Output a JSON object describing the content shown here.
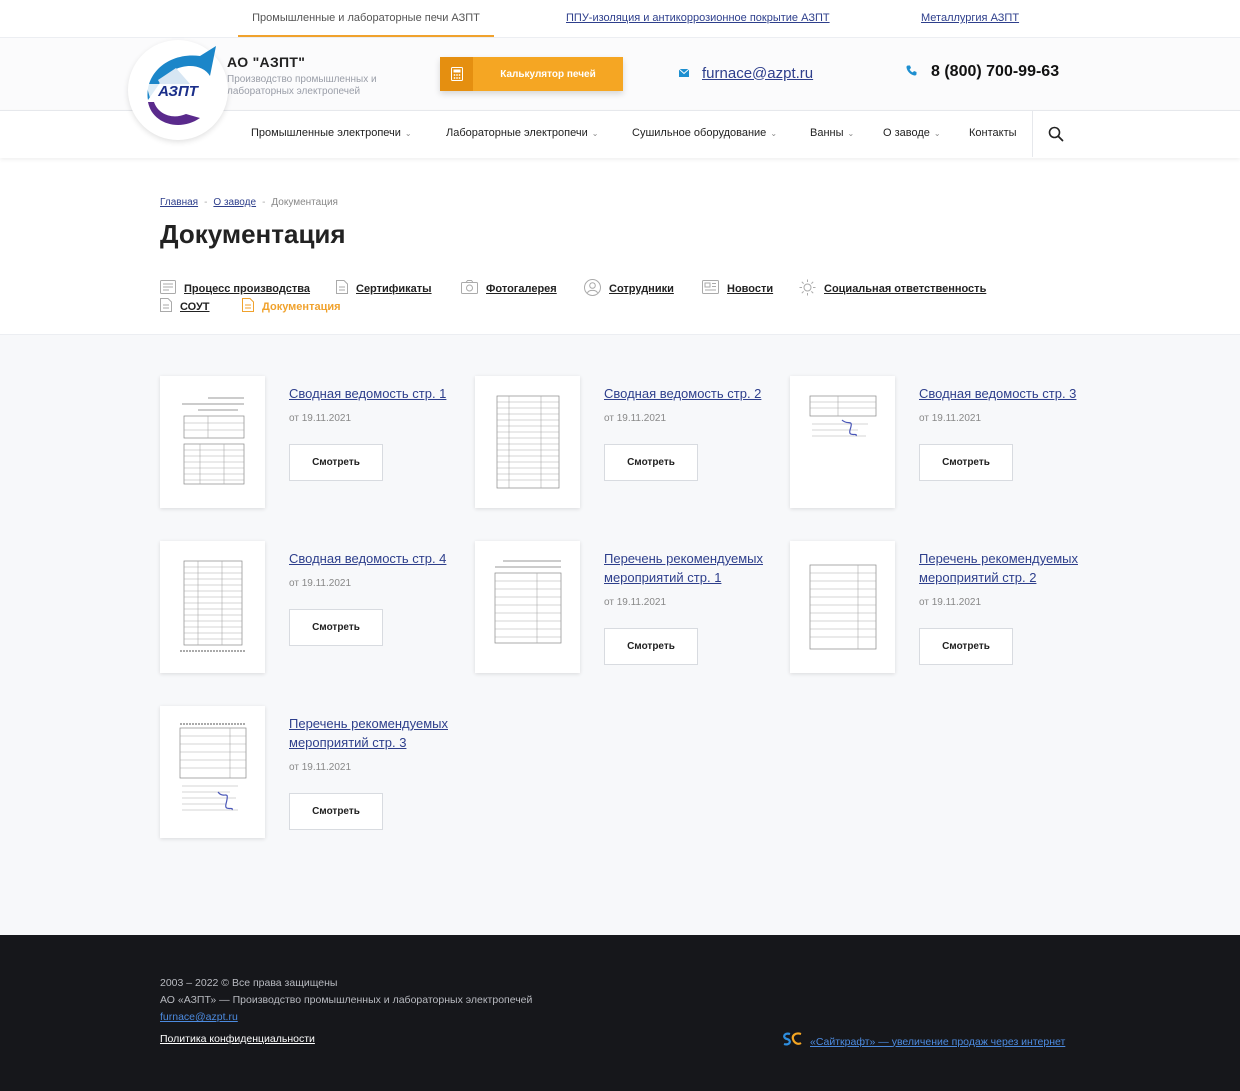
{
  "topbar": {
    "tabs": [
      {
        "label": "Промышленные и лабораторные печи АЗПТ"
      },
      {
        "label": "ППУ-изоляция и антикоррозионное покрытие АЗПТ"
      },
      {
        "label": "Металлургия АЗПТ"
      }
    ]
  },
  "header": {
    "logo_text": "АЗПТ",
    "company_name": "АО \"АЗПТ\"",
    "company_desc": "Производство промышленных и лабораторных электропечей",
    "calc_label": "Калькулятор печей",
    "email": "furnace@azpt.ru",
    "phone": "8 (800) 700-99-63"
  },
  "nav": {
    "items": [
      {
        "label": "Промышленные электропечи"
      },
      {
        "label": "Лабораторные электропечи"
      },
      {
        "label": "Сушильное оборудование"
      },
      {
        "label": "Ванны"
      },
      {
        "label": "О заводе"
      },
      {
        "label": "Контакты"
      }
    ],
    "chevron": "⌄"
  },
  "breadcrumb": {
    "items": [
      "Главная",
      "О заводе",
      "Документация"
    ],
    "separator": "-"
  },
  "page_title": "Документация",
  "subnav": {
    "items": [
      {
        "label": "Процесс производства",
        "icon": "list-icon"
      },
      {
        "label": "Сертификаты",
        "icon": "document-icon"
      },
      {
        "label": "Фотогалерея",
        "icon": "camera-icon"
      },
      {
        "label": "Сотрудники",
        "icon": "user-icon"
      },
      {
        "label": "Новости",
        "icon": "newspaper-icon"
      },
      {
        "label": "Социальная ответственность",
        "icon": "sun-icon"
      },
      {
        "label": "СОУТ",
        "icon": "document-icon"
      },
      {
        "label": "Документация",
        "icon": "document-icon"
      }
    ],
    "active_color": "#f0a22d"
  },
  "documents": [
    {
      "title": "Сводная ведомость стр. 1",
      "date": "от 19.11.2021",
      "button": "Смотреть"
    },
    {
      "title": "Сводная ведомость стр. 2",
      "date": "от 19.11.2021",
      "button": "Смотреть"
    },
    {
      "title": "Сводная ведомость стр. 3",
      "date": "от 19.11.2021",
      "button": "Смотреть"
    },
    {
      "title": "Сводная ведомость стр. 4",
      "date": "от 19.11.2021",
      "button": "Смотреть"
    },
    {
      "title": "Перечень рекомендуемых мероприятий стр. 1",
      "date": "от 19.11.2021",
      "button": "Смотреть"
    },
    {
      "title": "Перечень рекомендуемых мероприятий стр. 2",
      "date": "от 19.11.2021",
      "button": "Смотреть"
    },
    {
      "title": "Перечень рекомендуемых мероприятий стр. 3",
      "date": "от 19.11.2021",
      "button": "Смотреть"
    }
  ],
  "footer": {
    "copyright": "2003 – 2022 © Все права защищены",
    "company": "АО «АЗПТ» — Производство промышленных и лабораторных электропечей",
    "email": "furnace@azpt.ru",
    "privacy": "Политика конфиденциальности",
    "credit": "«Сайткрафт» — увеличение продаж через интернет"
  },
  "colors": {
    "accent": "#f5a623",
    "link": "#2e3f8c",
    "footer_bg": "#16171b"
  }
}
